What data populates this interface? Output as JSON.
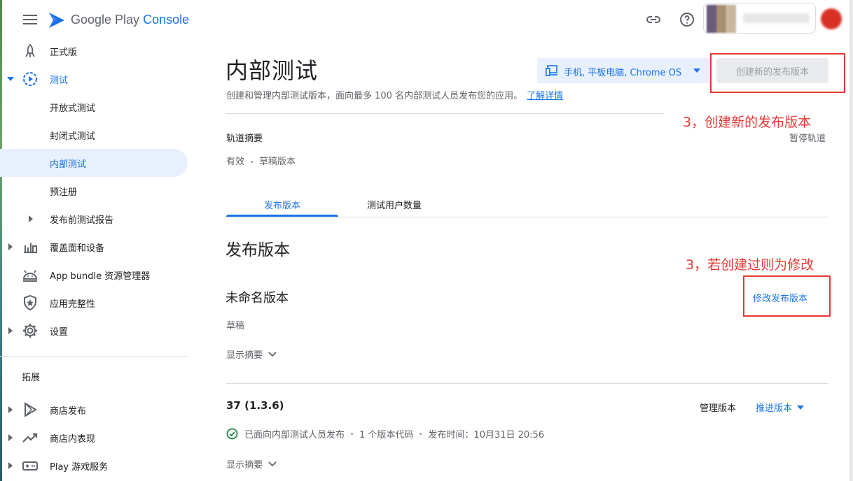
{
  "header": {
    "brand_main": "Google Play",
    "brand_console": "Console",
    "icons": [
      "menu-icon",
      "link-icon",
      "help-icon"
    ]
  },
  "sidebar": {
    "items": [
      {
        "label": "正式版",
        "icon": "rocket-icon"
      },
      {
        "label": "测试",
        "icon": "play-circle-icon"
      },
      {
        "label": "开放式测试"
      },
      {
        "label": "封闭式测试"
      },
      {
        "label": "内部测试"
      },
      {
        "label": "预注册"
      },
      {
        "label": "发布前测试报告"
      },
      {
        "label": "覆盖面和设备",
        "icon": "bar-chart-icon"
      },
      {
        "label": "App bundle 资源管理器",
        "icon": "android-icon"
      },
      {
        "label": "应用完整性",
        "icon": "shield-icon"
      },
      {
        "label": "设置",
        "icon": "gear-icon"
      }
    ],
    "section_label": "拓展",
    "ext_items": [
      {
        "label": "商店发布",
        "icon": "play-icon"
      },
      {
        "label": "商店内表现",
        "icon": "trending-icon"
      },
      {
        "label": "Play 游戏服务",
        "icon": "gamepad-icon"
      }
    ]
  },
  "main": {
    "title": "内部测试",
    "description": "创建和管理内部测试版本，面向最多 100 名内部测试人员发布您的应用。",
    "learn_more": "了解详情",
    "device_selector": "手机, 平板电脑, Chrome OS",
    "create_button": "创建新的发布版本",
    "track_summary_label": "轨道摘要",
    "pause_track": "暂停轨道",
    "track_status": "有效",
    "track_draft": "草稿版本",
    "tabs": [
      {
        "label": "发布版本"
      },
      {
        "label": "测试用户数量"
      }
    ],
    "section_title": "发布版本",
    "draft_release": {
      "name": "未命名版本",
      "status": "草稿",
      "edit_button": "修改发布版本",
      "show_summary": "显示摘要"
    },
    "release_37": {
      "name": "37 (1.3.6)",
      "manage": "管理版本",
      "promote": "推进版本",
      "status": "已面向内部测试人员发布",
      "codes": "1 个版本代码",
      "published": "发布时间：10月31日 20:56",
      "show_summary": "显示摘要"
    }
  },
  "annotations": {
    "a1": "3，创建新的发布版本",
    "a2": "3，若创建过则为修改"
  },
  "colors": {
    "accent": "#1a73e8",
    "annotation_red": "#e53935",
    "success_green": "#188038"
  }
}
